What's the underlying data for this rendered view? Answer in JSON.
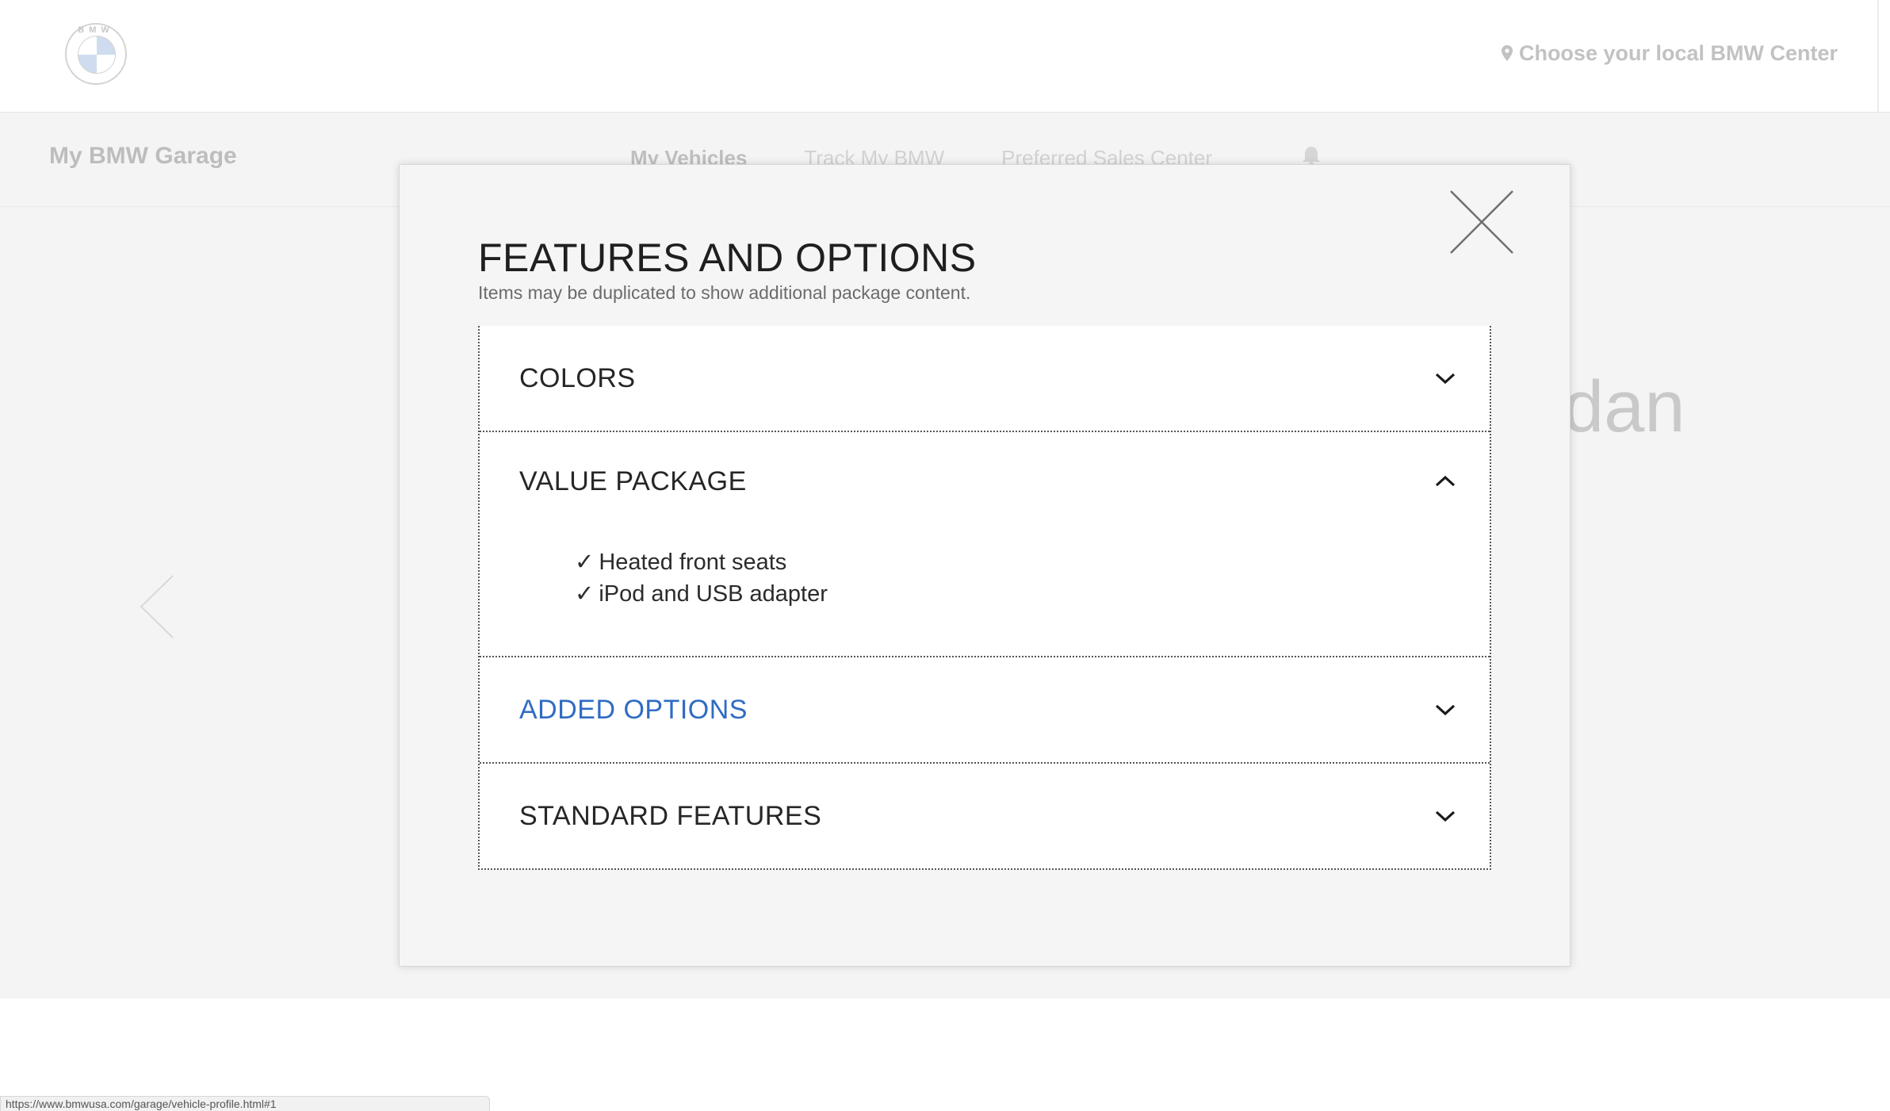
{
  "header": {
    "logo_letters": "BMW",
    "dealer_link": "Choose your local BMW Center"
  },
  "subnav": {
    "title": "My BMW Garage",
    "links": [
      {
        "label": "My Vehicles",
        "active": true
      },
      {
        "label": "Track My BMW",
        "active": false
      },
      {
        "label": "Preferred Sales Center",
        "active": false
      }
    ]
  },
  "hero": {
    "partial_title": "dan"
  },
  "status_bar": {
    "url": "https://www.bmwusa.com/garage/vehicle-profile.html#1"
  },
  "modal": {
    "title": "FEATURES AND OPTIONS",
    "subtitle": "Items may be duplicated to show additional package content.",
    "sections": [
      {
        "label": "COLORS",
        "expanded": false
      },
      {
        "label": "VALUE PACKAGE",
        "expanded": true,
        "items": [
          "Heated front seats",
          "iPod and USB adapter"
        ]
      },
      {
        "label": "ADDED OPTIONS",
        "expanded": false
      },
      {
        "label": "STANDARD FEATURES",
        "expanded": false
      }
    ],
    "check_glyph": "✓"
  },
  "colors": {
    "link_blue": "#2f6bc4",
    "modal_bg": "#f5f5f5"
  }
}
